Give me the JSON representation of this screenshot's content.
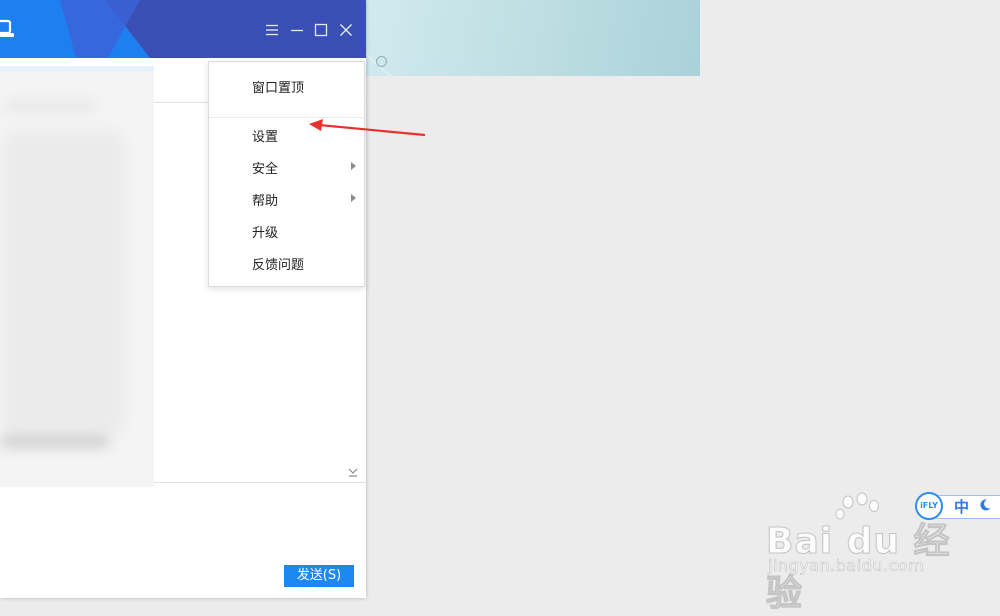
{
  "menu": {
    "items": [
      {
        "label": "窗口置顶",
        "has_submenu": false
      },
      {
        "label": "设置",
        "has_submenu": false
      },
      {
        "label": "安全",
        "has_submenu": true
      },
      {
        "label": "帮助",
        "has_submenu": true
      },
      {
        "label": "升级",
        "has_submenu": false
      },
      {
        "label": "反馈问题",
        "has_submenu": false
      }
    ]
  },
  "window": {
    "controls": [
      "menu-icon",
      "minimize-icon",
      "maximize-icon",
      "close-icon"
    ],
    "send_label": "发送(S)",
    "title_color": "#3a4fb4",
    "accent": "#1e88f0"
  },
  "ime": {
    "brand": "iFLY",
    "lang": "中"
  },
  "watermark": {
    "logo": "Bai  du 经验",
    "url": "jingyan.baidu.com"
  },
  "annotation": {
    "color": "#e8322e",
    "points_to": "设置"
  }
}
